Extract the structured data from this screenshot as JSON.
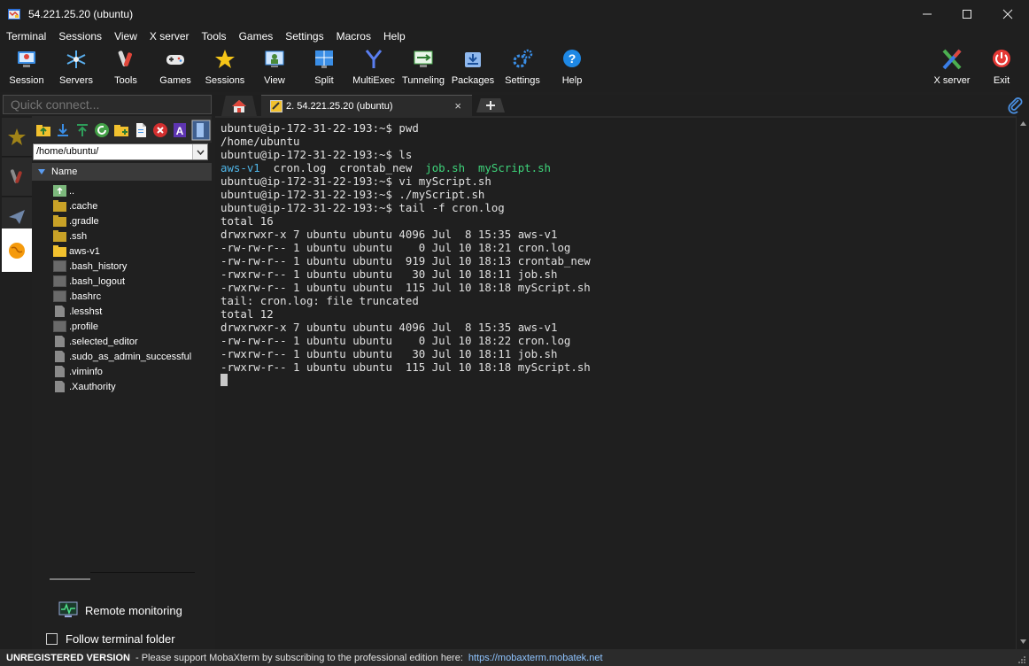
{
  "window": {
    "title": "54.221.25.20 (ubuntu)"
  },
  "menu": [
    "Terminal",
    "Sessions",
    "View",
    "X server",
    "Tools",
    "Games",
    "Settings",
    "Macros",
    "Help"
  ],
  "toolbar": {
    "buttons": [
      {
        "label": "Session",
        "icon": "session-icon"
      },
      {
        "label": "Servers",
        "icon": "servers-icon"
      },
      {
        "label": "Tools",
        "icon": "tools-icon"
      },
      {
        "label": "Games",
        "icon": "gamepad-icon"
      },
      {
        "label": "Sessions",
        "icon": "star-icon"
      },
      {
        "label": "View",
        "icon": "view-icon"
      },
      {
        "label": "Split",
        "icon": "split-icon"
      },
      {
        "label": "MultiExec",
        "icon": "multiexec-icon"
      },
      {
        "label": "Tunneling",
        "icon": "tunneling-icon"
      },
      {
        "label": "Packages",
        "icon": "packages-icon"
      },
      {
        "label": "Settings",
        "icon": "settings-icon"
      },
      {
        "label": "Help",
        "icon": "help-icon"
      }
    ],
    "right_buttons": [
      {
        "label": "X server",
        "icon": "xserver-icon"
      },
      {
        "label": "Exit",
        "icon": "power-icon"
      }
    ]
  },
  "quick_connect": {
    "placeholder": "Quick connect..."
  },
  "sftp": {
    "path": "/home/ubuntu/",
    "column_header": "Name",
    "files": [
      {
        "name": "..",
        "type": "parent"
      },
      {
        "name": ".cache",
        "type": "folder"
      },
      {
        "name": ".gradle",
        "type": "folder"
      },
      {
        "name": ".ssh",
        "type": "folder"
      },
      {
        "name": "aws-v1",
        "type": "folder-open"
      },
      {
        "name": ".bash_history",
        "type": "file-dark"
      },
      {
        "name": ".bash_logout",
        "type": "file-dark"
      },
      {
        "name": ".bashrc",
        "type": "file-dark"
      },
      {
        "name": ".lesshst",
        "type": "file"
      },
      {
        "name": ".profile",
        "type": "file-dark"
      },
      {
        "name": ".selected_editor",
        "type": "file"
      },
      {
        "name": ".sudo_as_admin_successful",
        "type": "file"
      },
      {
        "name": ".viminfo",
        "type": "file"
      },
      {
        "name": ".Xauthority",
        "type": "file"
      }
    ],
    "remote_monitoring_label": "Remote monitoring",
    "follow_folder_label": "Follow terminal folder",
    "follow_folder_checked": false
  },
  "tabs": {
    "session_tab_label": "2. 54.221.25.20 (ubuntu)",
    "close_glyph": "×"
  },
  "terminal": {
    "lines": [
      {
        "segments": [
          {
            "text": "ubuntu@ip-172-31-22-193:~$ pwd"
          }
        ]
      },
      {
        "segments": [
          {
            "text": "/home/ubuntu"
          }
        ]
      },
      {
        "segments": [
          {
            "text": "ubuntu@ip-172-31-22-193:~$ ls"
          }
        ]
      },
      {
        "segments": [
          {
            "text": "aws-v1",
            "cls": "dir"
          },
          {
            "text": "  cron.log  crontab_new  "
          },
          {
            "text": "job.sh",
            "cls": "exe"
          },
          {
            "text": "  "
          },
          {
            "text": "myScript.sh",
            "cls": "exe"
          }
        ]
      },
      {
        "segments": [
          {
            "text": "ubuntu@ip-172-31-22-193:~$ vi myScript.sh"
          }
        ]
      },
      {
        "segments": [
          {
            "text": "ubuntu@ip-172-31-22-193:~$ ./myScript.sh"
          }
        ]
      },
      {
        "segments": [
          {
            "text": "ubuntu@ip-172-31-22-193:~$ tail -f cron.log"
          }
        ]
      },
      {
        "segments": [
          {
            "text": "total 16"
          }
        ]
      },
      {
        "segments": [
          {
            "text": "drwxrwxr-x 7 ubuntu ubuntu 4096 Jul  8 15:35 aws-v1"
          }
        ]
      },
      {
        "segments": [
          {
            "text": "-rw-rw-r-- 1 ubuntu ubuntu    0 Jul 10 18:21 cron.log"
          }
        ]
      },
      {
        "segments": [
          {
            "text": "-rw-rw-r-- 1 ubuntu ubuntu  919 Jul 10 18:13 crontab_new"
          }
        ]
      },
      {
        "segments": [
          {
            "text": "-rwxrw-r-- 1 ubuntu ubuntu   30 Jul 10 18:11 job.sh"
          }
        ]
      },
      {
        "segments": [
          {
            "text": "-rwxrw-r-- 1 ubuntu ubuntu  115 Jul 10 18:18 myScript.sh"
          }
        ]
      },
      {
        "segments": [
          {
            "text": "tail: cron.log: file truncated"
          }
        ]
      },
      {
        "segments": [
          {
            "text": "total 12"
          }
        ]
      },
      {
        "segments": [
          {
            "text": "drwxrwxr-x 7 ubuntu ubuntu 4096 Jul  8 15:35 aws-v1"
          }
        ]
      },
      {
        "segments": [
          {
            "text": "-rw-rw-r-- 1 ubuntu ubuntu    0 Jul 10 18:22 cron.log"
          }
        ]
      },
      {
        "segments": [
          {
            "text": "-rwxrw-r-- 1 ubuntu ubuntu   30 Jul 10 18:11 job.sh"
          }
        ]
      },
      {
        "segments": [
          {
            "text": "-rwxrw-r-- 1 ubuntu ubuntu  115 Jul 10 18:18 myScript.sh"
          }
        ]
      }
    ]
  },
  "statusbar": {
    "unregistered": "UNREGISTERED VERSION",
    "message": "-  Please support MobaXterm by subscribing to the professional edition here:",
    "link": "https://mobaxterm.mobatek.net"
  },
  "colors": {
    "directory": "#4fb6e8",
    "executable": "#3ed37a",
    "background": "#1f1f1f"
  }
}
